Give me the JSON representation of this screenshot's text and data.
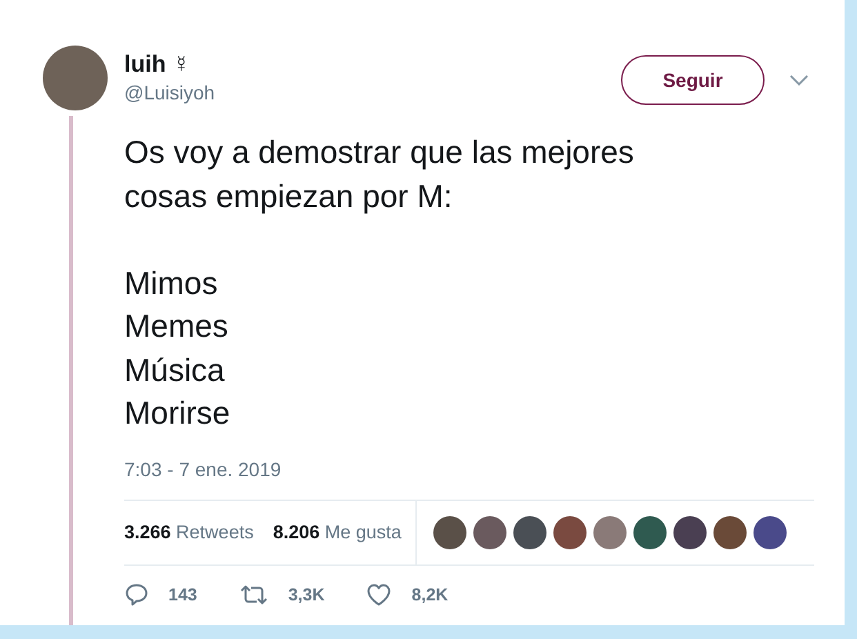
{
  "author": {
    "name": "luih ☿",
    "handle": "@Luisiyoh"
  },
  "follow_button": {
    "label": "Seguir"
  },
  "tweet": {
    "paragraphs": [
      [
        "Os voy a demostrar que las mejores",
        "cosas empiezan por M:"
      ],
      [
        "Mimos",
        "Memes",
        "Música",
        "Morirse"
      ]
    ],
    "timestamp": "7:03 - 7 ene. 2019"
  },
  "stats": [
    {
      "count": "3.266",
      "label": "Retweets"
    },
    {
      "count": "8.206",
      "label": "Me gusta"
    }
  ],
  "likers": [
    {
      "kind": "photo"
    },
    {
      "kind": "photo"
    },
    {
      "kind": "photo"
    },
    {
      "kind": "photo"
    },
    {
      "kind": "photo"
    },
    {
      "kind": "photo"
    },
    {
      "kind": "photo"
    },
    {
      "kind": "photo"
    },
    {
      "kind": "photo"
    }
  ],
  "actions": [
    {
      "kind": "reply",
      "count": "143"
    },
    {
      "kind": "retweet",
      "count": "3,3K"
    },
    {
      "kind": "like",
      "count": "8,2K"
    }
  ]
}
